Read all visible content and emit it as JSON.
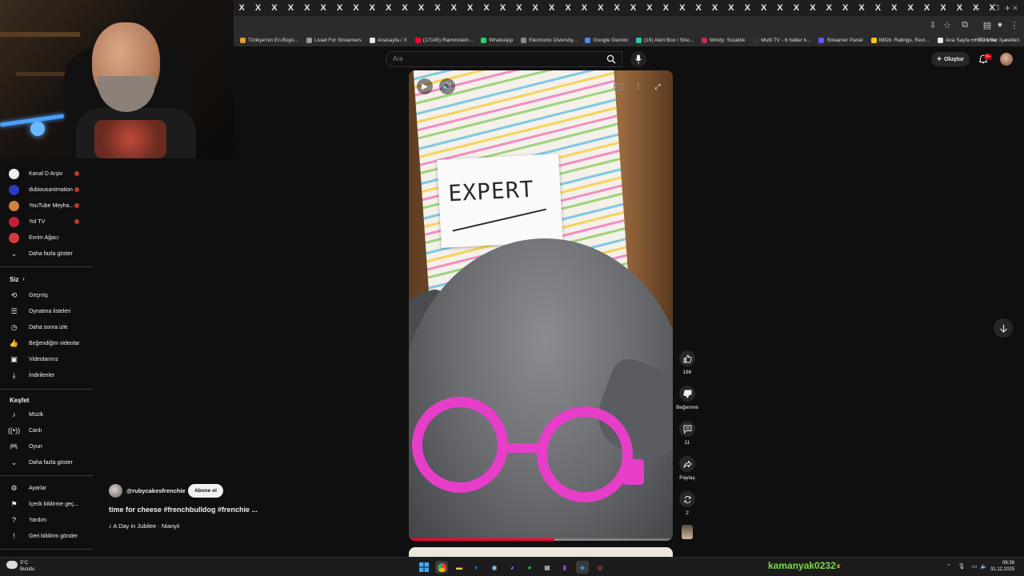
{
  "browser": {
    "tabs": [
      "X",
      "X",
      "X",
      "X",
      "X",
      "X",
      "X",
      "X",
      "X",
      "X",
      "X",
      "X",
      "X",
      "X",
      "X",
      "X",
      "X",
      "X",
      "X",
      "X",
      "X",
      "X",
      "X",
      "X",
      "X",
      "X",
      "X",
      "X",
      "X",
      "X",
      "X",
      "X",
      "X",
      "X",
      "X",
      "X",
      "X",
      "X",
      "X",
      "X",
      "X",
      "X",
      "X",
      "X",
      "X",
      "X",
      "X"
    ],
    "new_tab": "+",
    "bookmarks": [
      {
        "label": "Türkiye'nin En Büyü...",
        "color": "#e0a030"
      },
      {
        "label": "Livad For Streamers",
        "color": "#9a9a9a"
      },
      {
        "label": "Anasayfa / X",
        "color": "#e8e8e8"
      },
      {
        "label": "(17145) Rammstein...",
        "color": "#ff0033"
      },
      {
        "label": "WhatsApp",
        "color": "#25d366"
      },
      {
        "label": "Electronic Diversity...",
        "color": "#8a8a8a"
      },
      {
        "label": "Google Gemini",
        "color": "#4a8af4"
      },
      {
        "label": "(19) Alert Box / Stre...",
        "color": "#31c3a2"
      },
      {
        "label": "Windy: Sıcaklık",
        "color": "#c0304a"
      },
      {
        "label": "Multi TV - 6 haber k...",
        "color": "#333333"
      },
      {
        "label": "Streamer Panel",
        "color": "#5a5aff"
      },
      {
        "label": "IMDb: Ratings, Revi...",
        "color": "#f5c518"
      },
      {
        "label": "Ana Sayfa • HBO Max",
        "color": "#e8e8e8"
      }
    ],
    "bookmarks_more": "»",
    "all_bookmarks": "Tüm Yer İşaretleri"
  },
  "sidebar": {
    "subscriptions": [
      {
        "label": "Kanal D Arşiv",
        "color": "#f0f0f0",
        "live": true
      },
      {
        "label": "dubiousanimation",
        "color": "#2a3ac0",
        "live": true
      },
      {
        "label": "YouTube Meyha...",
        "color": "#d08040",
        "live": true
      },
      {
        "label": "Yol TV",
        "color": "#c0203a",
        "live": true
      },
      {
        "label": "Evrim Ağacı",
        "color": "#d23b3b",
        "live": false
      }
    ],
    "show_more_1": "Daha fazla göster",
    "you_header": "Siz",
    "you_items": [
      {
        "label": "Geçmiş",
        "icon": "history-icon",
        "glyph": "⟲"
      },
      {
        "label": "Oynatma listeleri",
        "icon": "playlist-icon",
        "glyph": "☰"
      },
      {
        "label": "Daha sonra izle",
        "icon": "watch-later-icon",
        "glyph": "◷"
      },
      {
        "label": "Beğendiğim videolar",
        "icon": "like-icon",
        "glyph": "👍"
      },
      {
        "label": "Videolarınız",
        "icon": "your-videos-icon",
        "glyph": "▣"
      },
      {
        "label": "İndirilenler",
        "icon": "download-icon",
        "glyph": "⤓"
      }
    ],
    "explore_header": "Keşfet",
    "explore_items": [
      {
        "label": "Müzik",
        "icon": "music-icon",
        "glyph": "♪"
      },
      {
        "label": "Canlı",
        "icon": "live-icon",
        "glyph": "((•))"
      },
      {
        "label": "Oyun",
        "icon": "gaming-icon",
        "glyph": "🎮"
      }
    ],
    "show_more_2": "Daha fazla göster",
    "footer_items": [
      {
        "label": "Ayarlar",
        "icon": "settings-icon",
        "glyph": "⚙"
      },
      {
        "label": "İçerik bildirme geç...",
        "icon": "flag-icon",
        "glyph": "⚑"
      },
      {
        "label": "Yardım",
        "icon": "help-icon",
        "glyph": "?"
      },
      {
        "label": "Geri bildirim gönder",
        "icon": "feedback-icon",
        "glyph": "!"
      }
    ]
  },
  "header": {
    "search_placeholder": "Ara",
    "create_label": "Oluştur",
    "notifications_badge": "9+"
  },
  "short": {
    "sign_text": "EXPERT",
    "progress_fraction": 0.55,
    "channel": "@rubycakesfrenchie",
    "subscribe_label": "Abone ol",
    "title": "time for cheese #frenchbulldog #frenchie ...",
    "music": "♪ A Day in Jubilee · Nianyii",
    "likes": "186",
    "dislike_label": "Beğenme",
    "comments": "11",
    "share_label": "Paylaş",
    "remix_count": "2"
  },
  "taskbar": {
    "weather_temp": "3°C",
    "weather_desc": "Bulutlu",
    "user": "kamanyak0232",
    "time": "08:36",
    "date": "31.12.2025"
  }
}
